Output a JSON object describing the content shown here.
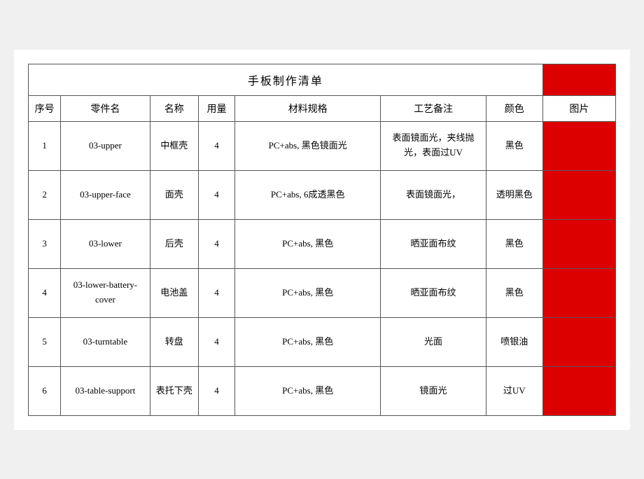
{
  "title": "手板制作清单",
  "headers": {
    "seq": "序号",
    "partname": "零件名",
    "name": "名称",
    "qty": "用量",
    "material": "材料规格",
    "process": "工艺备注",
    "color": "颜色",
    "image": "图片"
  },
  "rows": [
    {
      "seq": "1",
      "partname": "03-upper",
      "name": "中框壳",
      "qty": "4",
      "material": "PC+abs, 黑色镜面光",
      "process": "表面镜面光，夹线抛光，表面过UV",
      "color": "黑色"
    },
    {
      "seq": "2",
      "partname": "03-upper-face",
      "name": "面壳",
      "qty": "4",
      "material": "PC+abs, 6成透黑色",
      "process": "表面镜面光，",
      "color": "透明黑色"
    },
    {
      "seq": "3",
      "partname": "03-lower",
      "name": "后壳",
      "qty": "4",
      "material": "PC+abs, 黑色",
      "process": "晒亚面布纹",
      "color": "黑色"
    },
    {
      "seq": "4",
      "partname": "03-lower-battery-cover",
      "name": "电池盖",
      "qty": "4",
      "material": "PC+abs, 黑色",
      "process": "晒亚面布纹",
      "color": "黑色"
    },
    {
      "seq": "5",
      "partname": "03-turntable",
      "name": "转盘",
      "qty": "4",
      "material": "PC+abs, 黑色",
      "process": "光面",
      "color": "喷银油"
    },
    {
      "seq": "6",
      "partname": "03-table-support",
      "name": "表托下壳",
      "qty": "4",
      "material": "PC+abs, 黑色",
      "process": "镜面光",
      "color": "过UV"
    }
  ]
}
